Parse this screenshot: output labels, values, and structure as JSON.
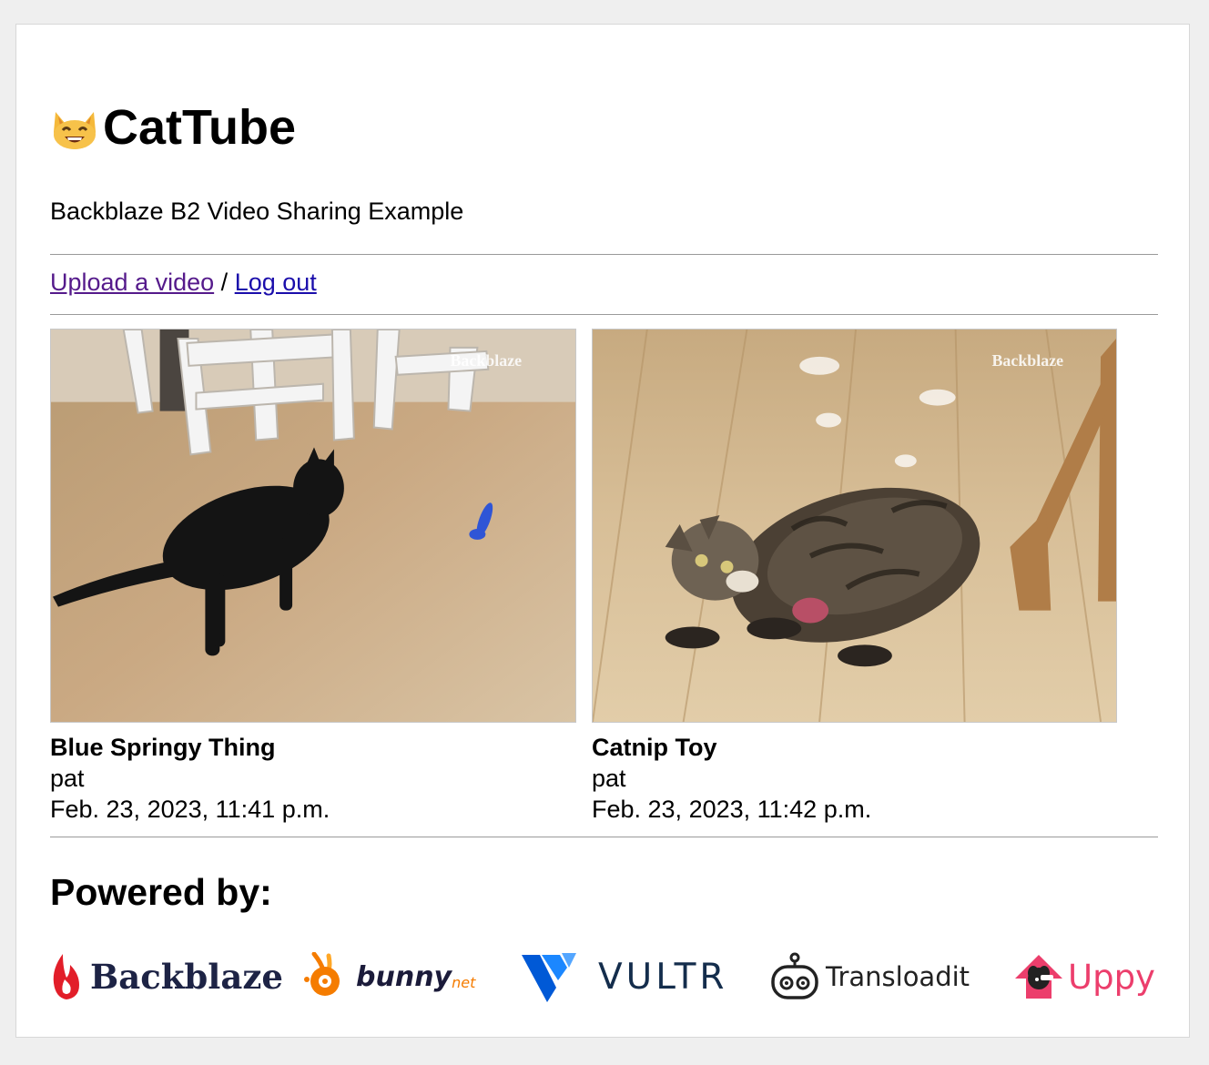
{
  "header": {
    "app_name": "CatTube",
    "logo_icon": "smiling-cat-emoji",
    "subtitle": "Backblaze B2 Video Sharing Example"
  },
  "nav": {
    "upload_label": "Upload a video",
    "separator": "/",
    "logout_label": "Log out"
  },
  "videos": [
    {
      "title": "Blue Springy Thing",
      "author": "pat",
      "date": "Feb. 23, 2023, 11:41 p.m.",
      "watermark": "Backblaze"
    },
    {
      "title": "Catnip Toy",
      "author": "pat",
      "date": "Feb. 23, 2023, 11:42 p.m.",
      "watermark": "Backblaze"
    }
  ],
  "footer": {
    "heading": "Powered by:",
    "logos": [
      {
        "name": "Backblaze",
        "color": "#e21e29",
        "text_color": "#1d2345"
      },
      {
        "name": "bunny",
        "suffix": "net",
        "color": "#f57c00",
        "text_color": "#1b1b3a"
      },
      {
        "name": "VULTR",
        "color": "#007bfc",
        "text_color": "#142d4c"
      },
      {
        "name": "Transloadit",
        "color": "#222222",
        "text_color": "#222222"
      },
      {
        "name": "Uppy",
        "color": "#ec3e6c",
        "text_color": "#ec3e6c"
      }
    ]
  },
  "colors": {
    "link": "#1a0dab",
    "link_visited": "#551a8b",
    "page_bg": "#efefef"
  }
}
